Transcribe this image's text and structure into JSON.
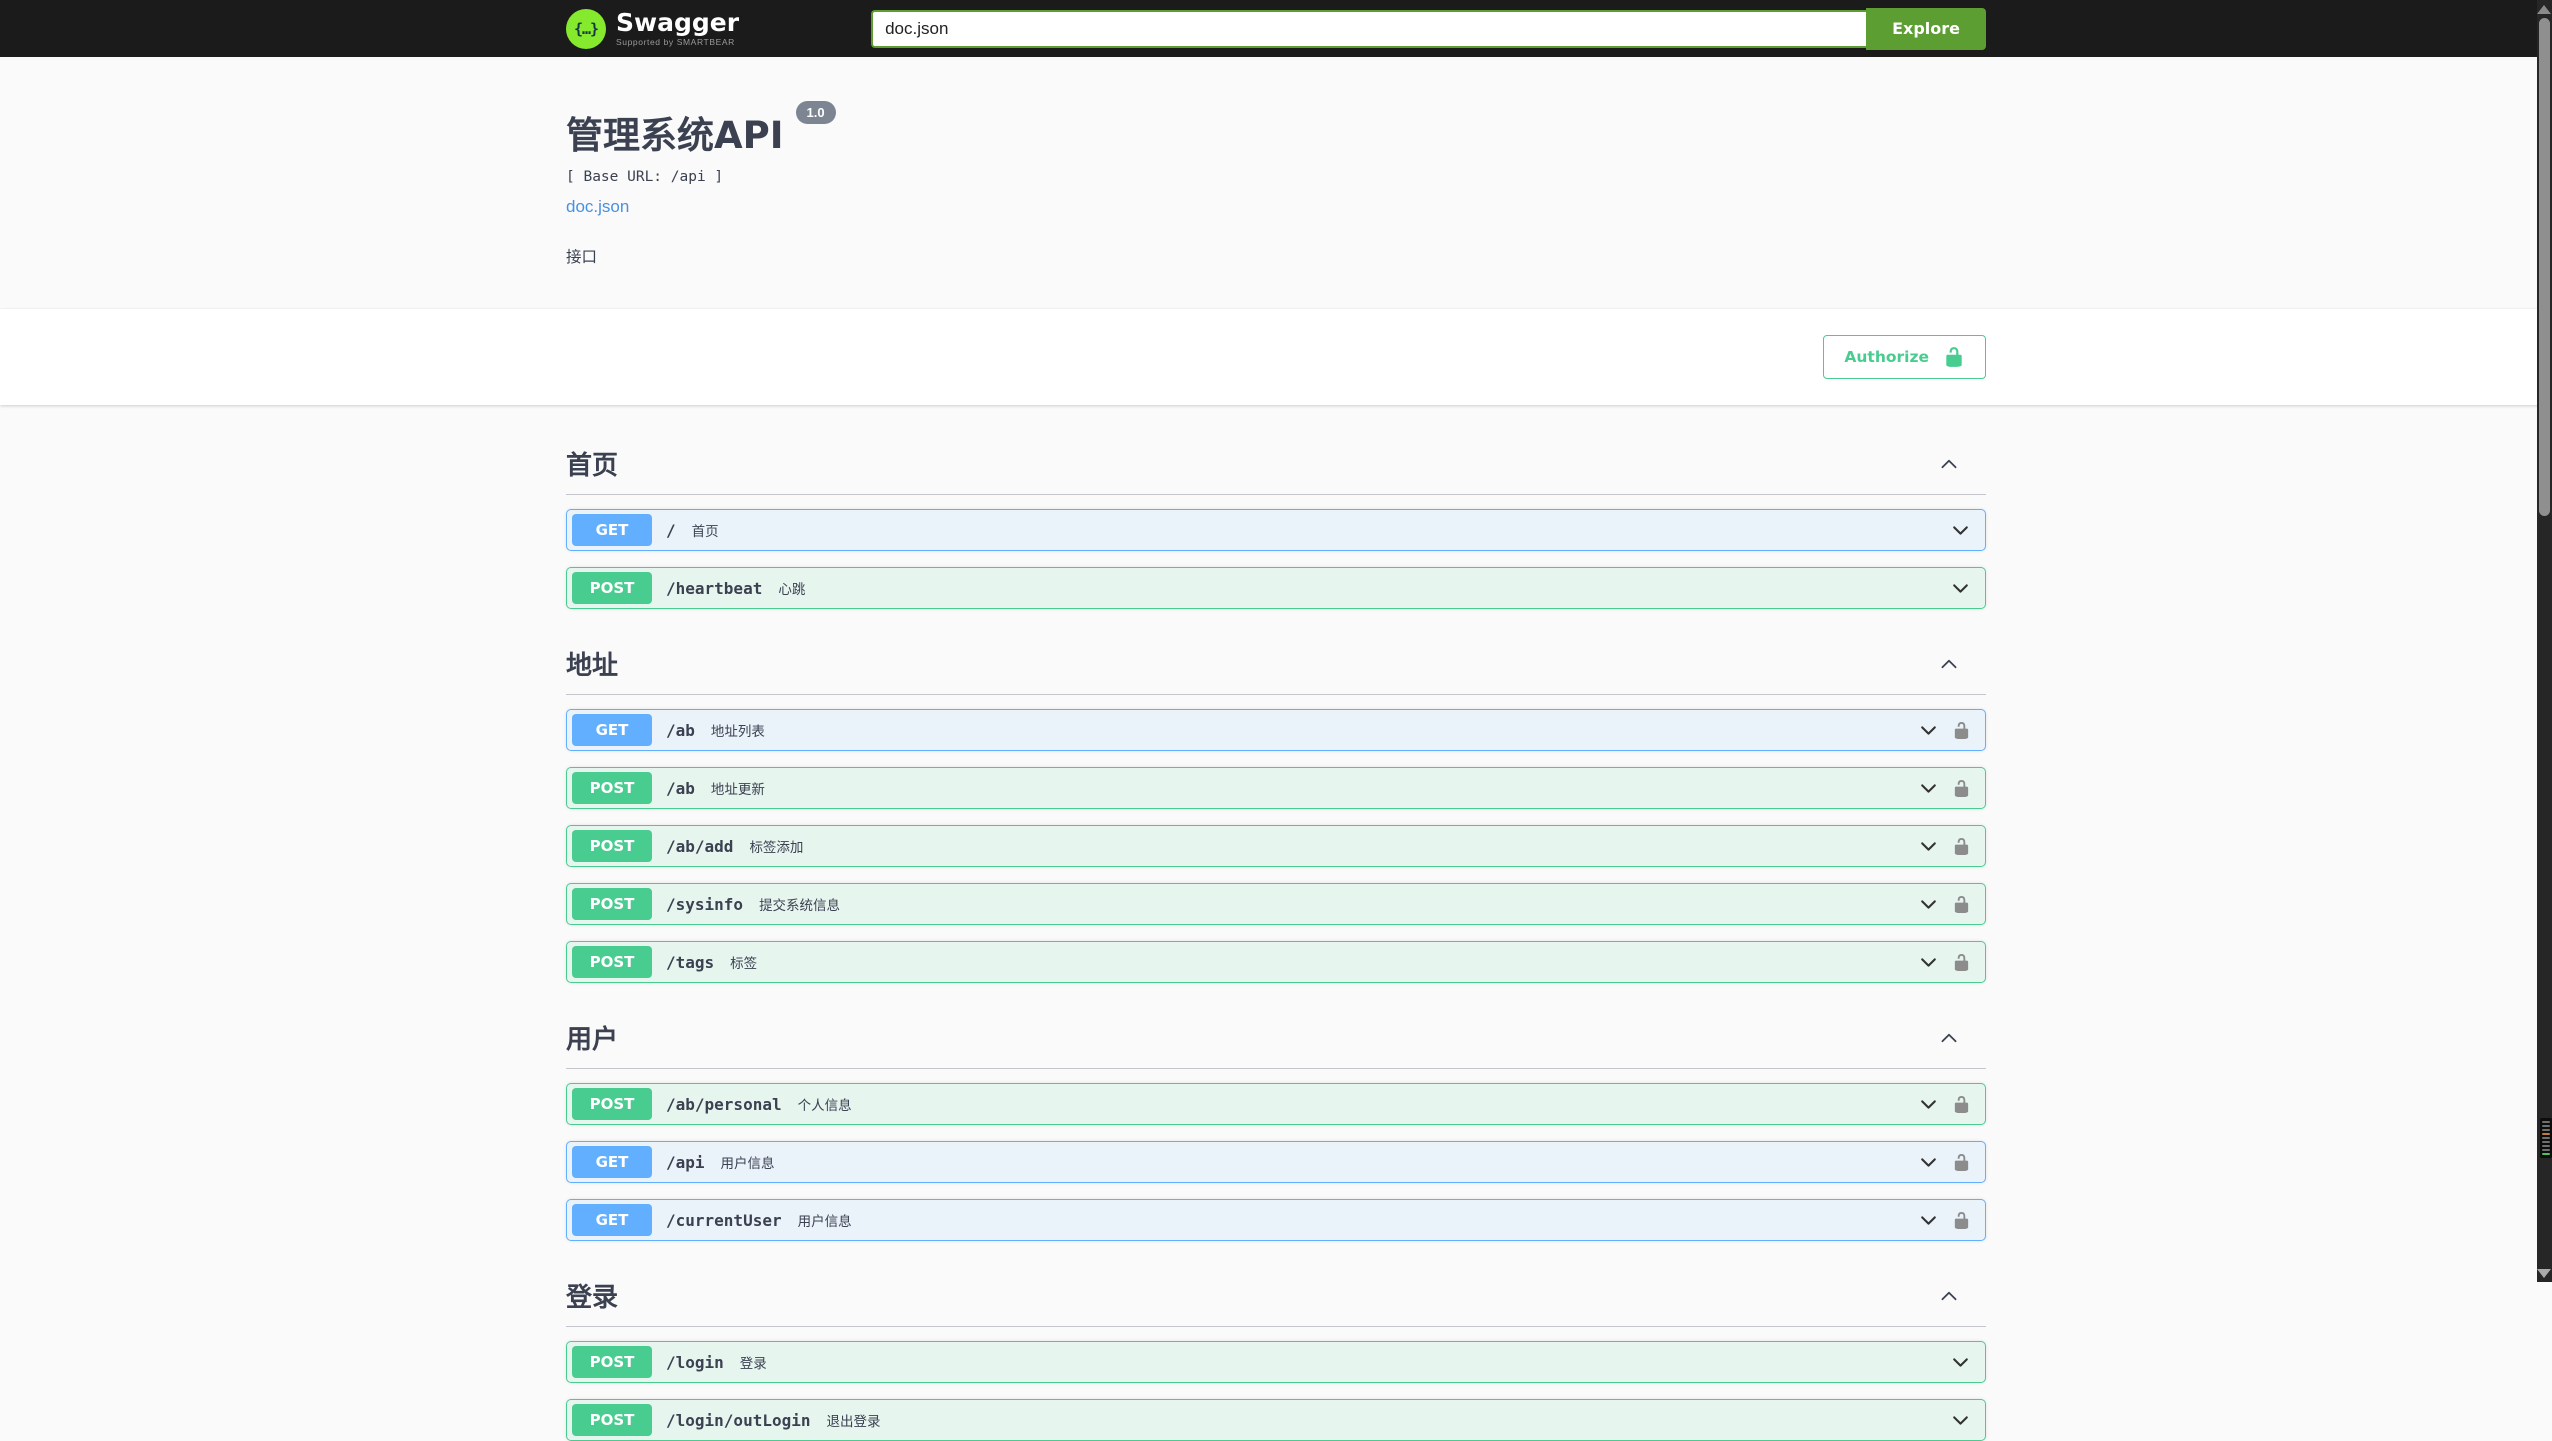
{
  "header": {
    "brand": "Swagger",
    "brand_sub": "Supported by SMARTBEAR",
    "logo_glyph": "{…}",
    "search_value": "doc.json",
    "explore_label": "Explore"
  },
  "info": {
    "title": "管理系统API",
    "version_badge": "1.0",
    "base_url_label": "[ Base URL: /api ]",
    "spec_link": "doc.json",
    "description": "接口"
  },
  "auth": {
    "authorize_label": "Authorize"
  },
  "colors": {
    "topbar_bg": "#1b1b1b",
    "explore_green": "#5c9e31",
    "logo_green": "#85ea2d",
    "get_blue": "#61affe",
    "post_green": "#49cc90",
    "authorize_green": "#49cc90",
    "link_blue": "#4990e2",
    "text_dark": "#3b4151",
    "version_badge_bg": "#7d8492"
  },
  "sections": [
    {
      "title": "首页",
      "operations": [
        {
          "method": "GET",
          "path": "/",
          "summary": "首页",
          "locked": false
        },
        {
          "method": "POST",
          "path": "/heartbeat",
          "summary": "心跳",
          "locked": false
        }
      ]
    },
    {
      "title": "地址",
      "operations": [
        {
          "method": "GET",
          "path": "/ab",
          "summary": "地址列表",
          "locked": true
        },
        {
          "method": "POST",
          "path": "/ab",
          "summary": "地址更新",
          "locked": true
        },
        {
          "method": "POST",
          "path": "/ab/add",
          "summary": "标签添加",
          "locked": true
        },
        {
          "method": "POST",
          "path": "/sysinfo",
          "summary": "提交系统信息",
          "locked": true
        },
        {
          "method": "POST",
          "path": "/tags",
          "summary": "标签",
          "locked": true
        }
      ]
    },
    {
      "title": "用户",
      "operations": [
        {
          "method": "POST",
          "path": "/ab/personal",
          "summary": "个人信息",
          "locked": true
        },
        {
          "method": "GET",
          "path": "/api",
          "summary": "用户信息",
          "locked": true
        },
        {
          "method": "GET",
          "path": "/currentUser",
          "summary": "用户信息",
          "locked": true
        }
      ]
    },
    {
      "title": "登录",
      "operations": [
        {
          "method": "POST",
          "path": "/login",
          "summary": "登录",
          "locked": false
        },
        {
          "method": "POST",
          "path": "/login/outLogin",
          "summary": "退出登录",
          "locked": false
        }
      ]
    }
  ]
}
